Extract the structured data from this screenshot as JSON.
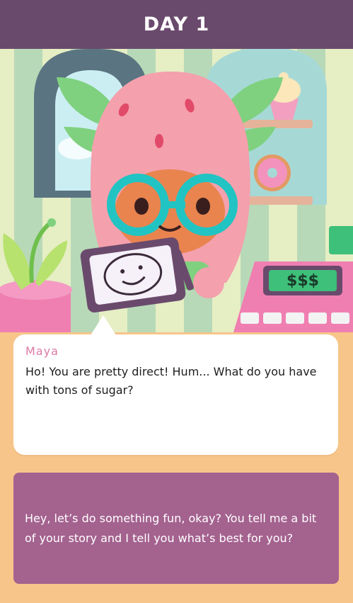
{
  "header": {
    "title": "DAY 1"
  },
  "scene": {
    "character": "strawberry-character",
    "tablet_icon": "smiley-drawing-icon",
    "register_display": "$$$"
  },
  "dialogue": {
    "speaker": "Maya",
    "text": "Ho! You are pretty direct! Hum... What do you have with tons of sugar?"
  },
  "response_option": {
    "text": "Hey, let’s do something fun, okay? You tell me a bit of your story and I tell you what’s best for you?"
  },
  "colors": {
    "header_bg": "#6a4a6c",
    "speaker_name": "#de7aa5",
    "response_bg": "#a4628f",
    "counter": "#f7c58a"
  }
}
